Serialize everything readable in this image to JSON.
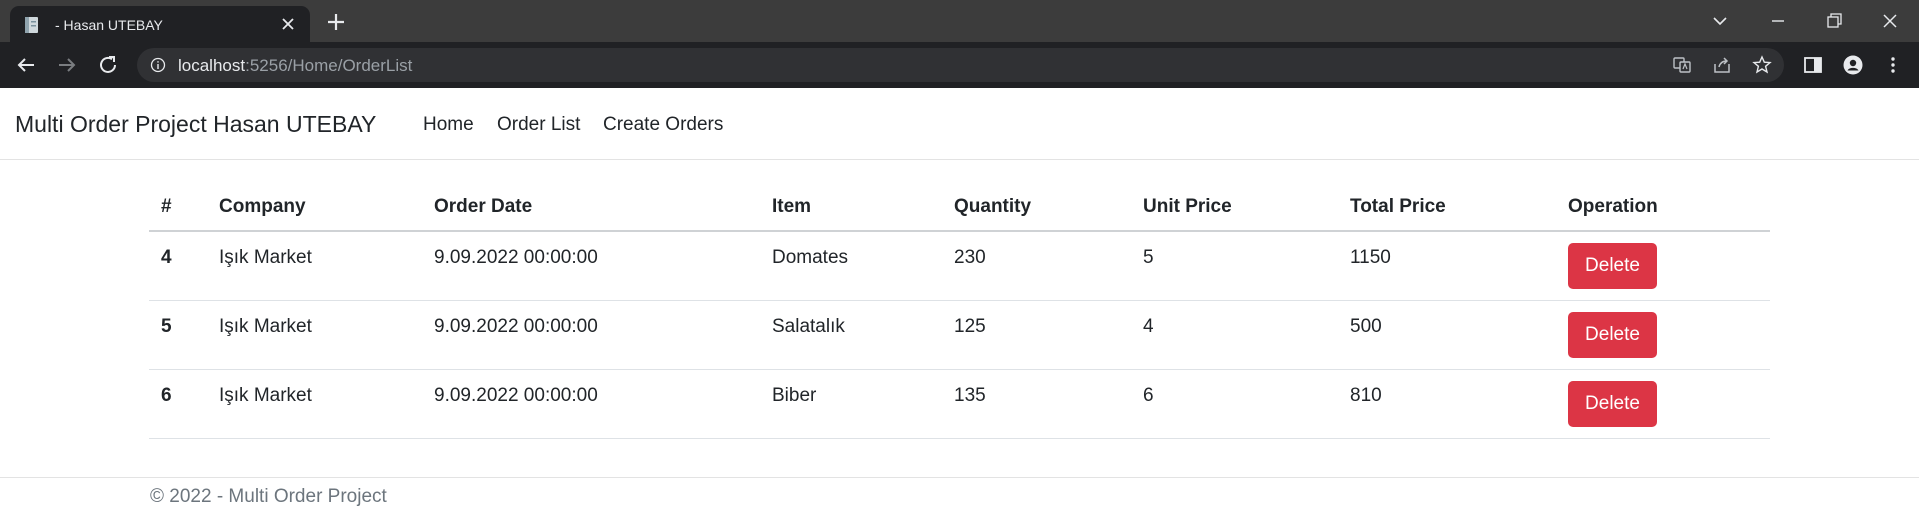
{
  "browser": {
    "tab_title": "- Hasan UTEBAY",
    "url_host": "localhost",
    "url_path": ":5256/Home/OrderList"
  },
  "navbar": {
    "brand": "Multi Order Project Hasan UTEBAY",
    "links": [
      "Home",
      "Order List",
      "Create Orders"
    ]
  },
  "table": {
    "headers": [
      "#",
      "Company",
      "Order Date",
      "Item",
      "Quantity",
      "Unit Price",
      "Total Price",
      "Operation"
    ],
    "rows": [
      {
        "id": "4",
        "company": "Işık Market",
        "date": "9.09.2022 00:00:00",
        "item": "Domates",
        "quantity": "230",
        "unit_price": "5",
        "total_price": "1150",
        "action": "Delete"
      },
      {
        "id": "5",
        "company": "Işık Market",
        "date": "9.09.2022 00:00:00",
        "item": "Salatalık",
        "quantity": "125",
        "unit_price": "4",
        "total_price": "500",
        "action": "Delete"
      },
      {
        "id": "6",
        "company": "Işık Market",
        "date": "9.09.2022 00:00:00",
        "item": "Biber",
        "quantity": "135",
        "unit_price": "6",
        "total_price": "810",
        "action": "Delete"
      }
    ]
  },
  "footer": {
    "text": "© 2022 - Multi Order Project"
  },
  "colors": {
    "danger": "#dc3545",
    "text": "#212529",
    "muted": "#6c757d",
    "chrome_dark": "#202124",
    "chrome_tabstrip": "#3c3c3c"
  }
}
